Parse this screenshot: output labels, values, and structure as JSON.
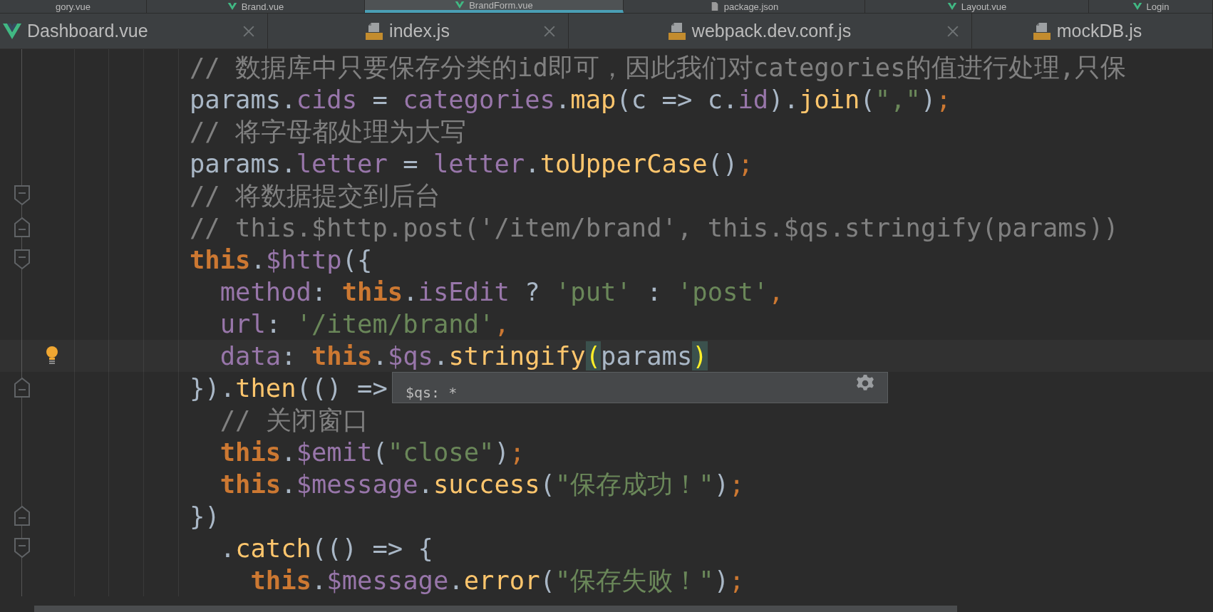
{
  "top_tabs": [
    {
      "label": "gory.vue",
      "kind": "none",
      "selected": false
    },
    {
      "label": "Brand.vue",
      "kind": "vue",
      "selected": false
    },
    {
      "label": "BrandForm.vue",
      "kind": "vue",
      "selected": true
    },
    {
      "label": "package.json",
      "kind": "json",
      "selected": false
    },
    {
      "label": "Layout.vue",
      "kind": "vue",
      "selected": false
    },
    {
      "label": "Login",
      "kind": "vue",
      "selected": false
    }
  ],
  "editor_tabs": [
    {
      "label": "Dashboard.vue",
      "kind": "vue",
      "closable": true
    },
    {
      "label": "index.js",
      "kind": "js",
      "closable": true
    },
    {
      "label": "webpack.dev.conf.js",
      "kind": "js",
      "closable": true
    },
    {
      "label": "mockDB.js",
      "kind": "js",
      "closable": false
    }
  ],
  "lines": [
    {
      "tokens": [
        {
          "t": "// 数据库中只要保存分类的id即可，因此我们对categories的值进行处理,只保",
          "kind": "comment"
        }
      ]
    },
    {
      "tokens": [
        {
          "t": "params.",
          "kind": "plain"
        },
        {
          "t": "cids",
          "kind": "field"
        },
        {
          "t": " = ",
          "kind": "plain"
        },
        {
          "t": "categories",
          "kind": "field"
        },
        {
          "t": ".",
          "kind": "plain"
        },
        {
          "t": "map",
          "kind": "function"
        },
        {
          "t": "(c => c.",
          "kind": "plain"
        },
        {
          "t": "id",
          "kind": "field"
        },
        {
          "t": ").",
          "kind": "plain"
        },
        {
          "t": "join",
          "kind": "function"
        },
        {
          "t": "(",
          "kind": "plain"
        },
        {
          "t": "\",\"",
          "kind": "string"
        },
        {
          "t": ")",
          "kind": "plain"
        },
        {
          "t": ";",
          "kind": "punct"
        }
      ]
    },
    {
      "tokens": [
        {
          "t": "// 将字母都处理为大写",
          "kind": "comment"
        }
      ]
    },
    {
      "tokens": [
        {
          "t": "params.",
          "kind": "plain"
        },
        {
          "t": "letter",
          "kind": "field"
        },
        {
          "t": " = ",
          "kind": "plain"
        },
        {
          "t": "letter",
          "kind": "field"
        },
        {
          "t": ".",
          "kind": "plain"
        },
        {
          "t": "toUpperCase",
          "kind": "function"
        },
        {
          "t": "()",
          "kind": "plain"
        },
        {
          "t": ";",
          "kind": "punct"
        }
      ]
    },
    {
      "fold_start": true,
      "tokens": [
        {
          "t": "// 将数据提交到后台",
          "kind": "comment"
        }
      ]
    },
    {
      "fold_end": true,
      "tokens": [
        {
          "t": "// this.$http.post('/item/brand', this.$qs.stringify(params))",
          "kind": "comment"
        }
      ]
    },
    {
      "fold_start": true,
      "tokens": [
        {
          "t": "this",
          "kind": "keyword"
        },
        {
          "t": ".",
          "kind": "plain"
        },
        {
          "t": "$http",
          "kind": "field"
        },
        {
          "t": "({",
          "kind": "plain"
        }
      ]
    },
    {
      "tokens": [
        {
          "t": "  method",
          "kind": "field"
        },
        {
          "t": ": ",
          "kind": "plain"
        },
        {
          "t": "this",
          "kind": "keyword"
        },
        {
          "t": ".",
          "kind": "plain"
        },
        {
          "t": "isEdit",
          "kind": "field"
        },
        {
          "t": " ? ",
          "kind": "plain"
        },
        {
          "t": "'put'",
          "kind": "string"
        },
        {
          "t": " : ",
          "kind": "plain"
        },
        {
          "t": "'post'",
          "kind": "string"
        },
        {
          "t": ",",
          "kind": "punct"
        }
      ]
    },
    {
      "tokens": [
        {
          "t": "  url",
          "kind": "field"
        },
        {
          "t": ": ",
          "kind": "plain"
        },
        {
          "t": "'/item/brand'",
          "kind": "string"
        },
        {
          "t": ",",
          "kind": "punct"
        }
      ]
    },
    {
      "current": true,
      "bulb": true,
      "tokens": [
        {
          "t": "  data",
          "kind": "field"
        },
        {
          "t": ": ",
          "kind": "plain"
        },
        {
          "t": "this",
          "kind": "keyword"
        },
        {
          "t": ".",
          "kind": "plain"
        },
        {
          "t": "$qs",
          "kind": "field"
        },
        {
          "t": ".",
          "kind": "plain"
        },
        {
          "t": "stringify",
          "kind": "function"
        },
        {
          "t": "(",
          "kind": "match"
        },
        {
          "t": "params",
          "kind": "plain"
        },
        {
          "t": ")",
          "kind": "match"
        }
      ]
    },
    {
      "fold_end": true,
      "tooltip": {
        "text": "$qs: *"
      },
      "tokens": [
        {
          "t": "}).",
          "kind": "plain"
        },
        {
          "t": "then",
          "kind": "function"
        },
        {
          "t": "(() =>",
          "kind": "plain"
        }
      ]
    },
    {
      "tokens": [
        {
          "t": "  // 关闭窗口",
          "kind": "comment"
        }
      ]
    },
    {
      "tokens": [
        {
          "t": "  this",
          "kind": "keyword"
        },
        {
          "t": ".",
          "kind": "plain"
        },
        {
          "t": "$emit",
          "kind": "field"
        },
        {
          "t": "(",
          "kind": "plain"
        },
        {
          "t": "\"close\"",
          "kind": "string"
        },
        {
          "t": ")",
          "kind": "plain"
        },
        {
          "t": ";",
          "kind": "punct"
        }
      ]
    },
    {
      "tokens": [
        {
          "t": "  this",
          "kind": "keyword"
        },
        {
          "t": ".",
          "kind": "plain"
        },
        {
          "t": "$message",
          "kind": "field"
        },
        {
          "t": ".",
          "kind": "plain"
        },
        {
          "t": "success",
          "kind": "function"
        },
        {
          "t": "(",
          "kind": "plain"
        },
        {
          "t": "\"保存成功！\"",
          "kind": "string"
        },
        {
          "t": ")",
          "kind": "plain"
        },
        {
          "t": ";",
          "kind": "punct"
        }
      ]
    },
    {
      "fold_end": true,
      "tokens": [
        {
          "t": "})",
          "kind": "plain"
        }
      ]
    },
    {
      "fold_start": true,
      "tokens": [
        {
          "t": "  .",
          "kind": "plain"
        },
        {
          "t": "catch",
          "kind": "function"
        },
        {
          "t": "(() => {",
          "kind": "plain"
        }
      ]
    },
    {
      "tokens": [
        {
          "t": "    this",
          "kind": "keyword"
        },
        {
          "t": ".",
          "kind": "plain"
        },
        {
          "t": "$message",
          "kind": "field"
        },
        {
          "t": ".",
          "kind": "plain"
        },
        {
          "t": "error",
          "kind": "function"
        },
        {
          "t": "(",
          "kind": "plain"
        },
        {
          "t": "\"保存失败！\"",
          "kind": "string"
        },
        {
          "t": ")",
          "kind": "plain"
        },
        {
          "t": ";",
          "kind": "punct"
        }
      ]
    }
  ]
}
